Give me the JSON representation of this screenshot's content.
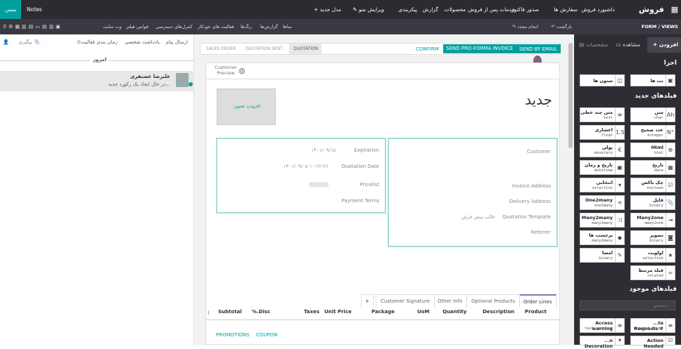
{
  "topbar": {
    "app_name": "فروش",
    "menu": [
      "داشبورد فروش",
      "سفارش ها",
      "صدور فاکتور",
      "خدمات پس از فروش",
      "محصولات",
      "گزارش",
      "پیکربندی"
    ],
    "edit_menu": "ویرایش منو",
    "new_model": "مدل جدید",
    "notes": "Notes",
    "close": "بستن"
  },
  "studio": {
    "breadcrumb": "FORM / VIEWS",
    "undo": "بازگشت",
    "redo": "انجام مجدد",
    "tabs": [
      "نماها",
      "گزارش‌ها",
      "رنگ‌ها",
      "فعالیت های خودکار",
      "کنترل‌های دسترسی",
      "قوانین فیلتر",
      "وب سایت"
    ]
  },
  "chatter": {
    "actions": [
      "ارسال پیام",
      "یادداشت شخصی",
      "زمان بندی فعالیت"
    ],
    "follow": "پیگیری",
    "day": "امروز",
    "author": "علیرضا غضنفری",
    "message": "در حال ایجاد یک رکورد جدید..."
  },
  "form": {
    "buttons": [
      "CONFIRM",
      "SEND PRO-FORMA INVOICE",
      "SEND BY EMAIL"
    ],
    "status": [
      "SALES ORDER",
      "QUOTATION SENT",
      "QUOTATION"
    ],
    "customer_preview": "Customer Preview",
    "add_image": "افزودن تصویر",
    "title": "جدید",
    "left_labels": [
      "Expiration",
      "Quotation Date",
      "Pricelist",
      "Payment Terms"
    ],
    "left_values": [
      "۱۴۰۱/۰۹/۱۵",
      "۱۴۰۱/۰۹/۰۵ ۱۰:۲۲:۲۶",
      "Pricelist",
      ""
    ],
    "right_labels": [
      "Customer",
      "Invoice Address",
      "Delivery Address",
      "Quotation Template",
      "Referrer"
    ],
    "quotation_template": "قالب پیش فرض",
    "tabs": [
      "Order Lines",
      "Optional Products",
      "Other Info",
      "Customer Signature"
    ],
    "columns": [
      "Product",
      "Description",
      "Quantity",
      "UoM",
      "Package",
      "Unit Price",
      "Taxes",
      "%.Disc",
      "Subtotal"
    ],
    "promotions": "PROMOTIONS",
    "coupon": "COUPON"
  },
  "sidebar": {
    "tabs": [
      "افزودن",
      "مشاهده",
      "مشخصات"
    ],
    "section_parts": "اجزا",
    "parts": [
      "نت ها",
      "ستون ها"
    ],
    "section_new": "فیلدهای جدید",
    "new_fields": [
      {
        "name": "متن",
        "type": "char",
        "icon": "Ah"
      },
      {
        "name": "متن چند خطی",
        "type": "text",
        "icon": "≡"
      },
      {
        "name": "عدد صحیح",
        "type": "integer",
        "icon": "N°"
      },
      {
        "name": "اعشاری",
        "type": "float",
        "icon": "1.5"
      },
      {
        "name": "Html",
        "type": "html",
        "icon": "⊕"
      },
      {
        "name": "پولی",
        "type": "monetary",
        "icon": "€"
      },
      {
        "name": "تاریخ",
        "type": "date",
        "icon": "▦"
      },
      {
        "name": "تاریخ و زمان",
        "type": "datetime",
        "icon": "▣"
      },
      {
        "name": "چک باکس",
        "type": "boolean",
        "icon": "☑"
      },
      {
        "name": "انتخابی",
        "type": "selection",
        "icon": "▾"
      },
      {
        "name": "فایل",
        "type": "binary",
        "icon": "📎"
      },
      {
        "name": "One2many",
        "type": "one2many",
        "icon": "⋖"
      },
      {
        "name": "Many2one",
        "type": "many2one",
        "icon": "⇥"
      },
      {
        "name": "Many2many",
        "type": "many2many",
        "icon": "⤨"
      },
      {
        "name": "تصویر",
        "type": "binary",
        "icon": "◙"
      },
      {
        "name": "برچسب ها",
        "type": "many2many",
        "icon": "◆"
      },
      {
        "name": "اولویت",
        "type": "selection",
        "icon": "★"
      },
      {
        "name": "امضا",
        "type": "binary",
        "icon": "✎"
      },
      {
        "name": "فیلد مرتبط",
        "type": "related",
        "icon": "∞"
      }
    ],
    "section_existing": "فیلدهای موجود",
    "search_placeholder": "جستجو...",
    "existing_fields": [
      {
        "name": "...te Requests #",
        "type": "request count",
        "icon": "≡"
      },
      {
        "name": "Access warning",
        "type": "text warning",
        "icon": "≡"
      },
      {
        "name": "Action Needed",
        "type": "boolean",
        "icon": "☑"
      },
      {
        "name": "...n Decoration",
        "type": "selection",
        "icon": "▾"
      }
    ]
  },
  "colors": {
    "accent": "#00a09d",
    "topbar": "#2d2a31",
    "sidebar": "#2e2d33"
  }
}
